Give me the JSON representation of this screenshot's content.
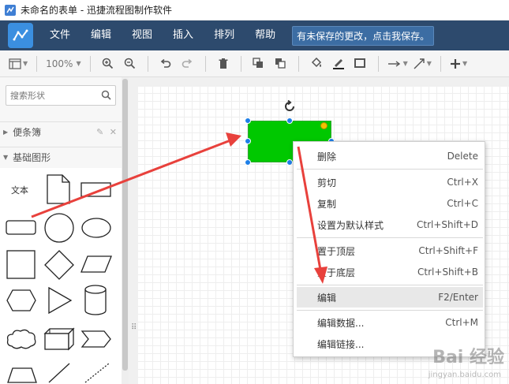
{
  "window": {
    "title": "未命名的表单 - 迅捷流程图制作软件"
  },
  "menubar": {
    "items": [
      "文件",
      "编辑",
      "视图",
      "插入",
      "排列",
      "帮助"
    ],
    "save_notice": "有未保存的更改，点击我保存。"
  },
  "toolbar": {
    "zoom": "100%"
  },
  "sidebar": {
    "search_placeholder": "搜索形状",
    "panels": [
      {
        "label": "便条簿",
        "expanded": false
      },
      {
        "label": "基础图形",
        "expanded": true
      }
    ],
    "shapes": {
      "text_label": "文本"
    }
  },
  "context_menu": {
    "items": [
      {
        "label": "删除",
        "shortcut": "Delete"
      },
      {
        "label": "剪切",
        "shortcut": "Ctrl+X"
      },
      {
        "label": "复制",
        "shortcut": "Ctrl+C"
      },
      {
        "label": "设置为默认样式",
        "shortcut": "Ctrl+Shift+D"
      },
      {
        "label": "置于顶层",
        "shortcut": "Ctrl+Shift+F"
      },
      {
        "label": "置于底层",
        "shortcut": "Ctrl+Shift+B"
      },
      {
        "label": "编辑",
        "shortcut": "F2/Enter",
        "active": true
      },
      {
        "label": "编辑数据...",
        "shortcut": "Ctrl+M"
      },
      {
        "label": "编辑链接...",
        "shortcut": ""
      }
    ]
  },
  "colors": {
    "menubar": "#2d4a6d",
    "shape_fill": "#00c800",
    "handle": "#1e7fe8",
    "annotation_arrow": "#e8413c"
  },
  "watermark": {
    "main": "Bai 经验",
    "sub": "jingyan.baidu.com"
  }
}
